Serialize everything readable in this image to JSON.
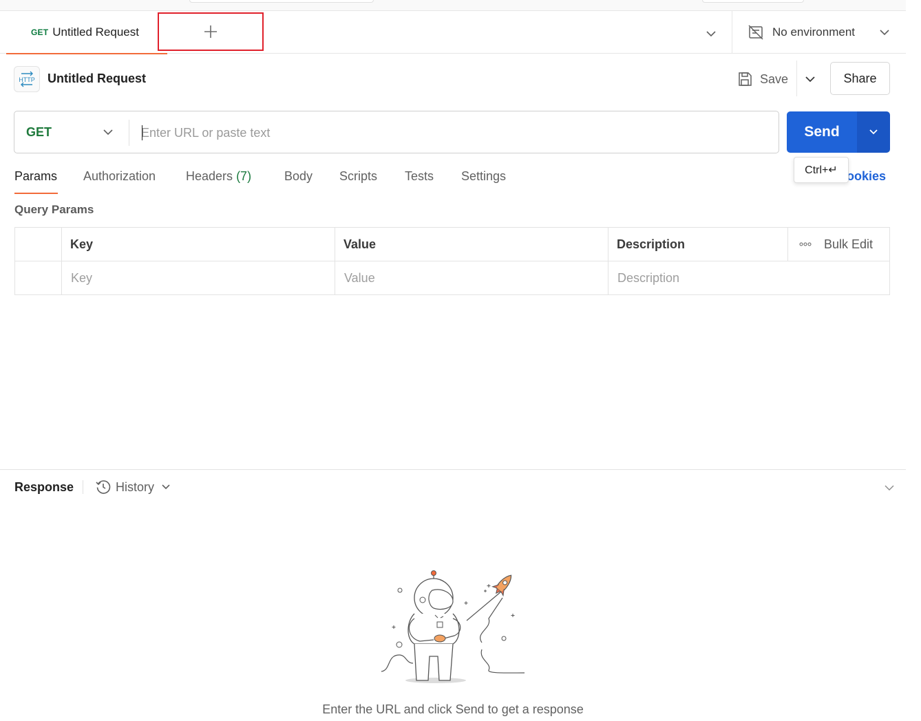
{
  "tab": {
    "method": "GET",
    "title": "Untitled Request"
  },
  "environment": {
    "label": "No environment"
  },
  "request": {
    "title": "Untitled Request",
    "save_label": "Save",
    "share_label": "Share",
    "method": "GET",
    "url_value": "",
    "url_placeholder": "Enter URL or paste text",
    "send_label": "Send",
    "send_shortcut": "Ctrl+↵",
    "cookies_label": "Cookies"
  },
  "request_tabs": [
    {
      "label": "Params"
    },
    {
      "label": "Authorization"
    },
    {
      "label": "Headers",
      "count": "(7)"
    },
    {
      "label": "Body"
    },
    {
      "label": "Scripts"
    },
    {
      "label": "Tests"
    },
    {
      "label": "Settings"
    }
  ],
  "query_params": {
    "title": "Query Params",
    "headers": {
      "key": "Key",
      "value": "Value",
      "description": "Description",
      "bulk_edit": "Bulk Edit"
    },
    "empty_row": {
      "key": "Key",
      "value": "Value",
      "description": "Description"
    }
  },
  "response": {
    "title": "Response",
    "history_label": "History",
    "empty_message": "Enter the URL and click Send to get a response"
  },
  "colors": {
    "accent_orange": "#f26b3a",
    "send_blue": "#1f63d8",
    "get_green": "#1f7a3c",
    "highlight_red": "#e0202b"
  }
}
